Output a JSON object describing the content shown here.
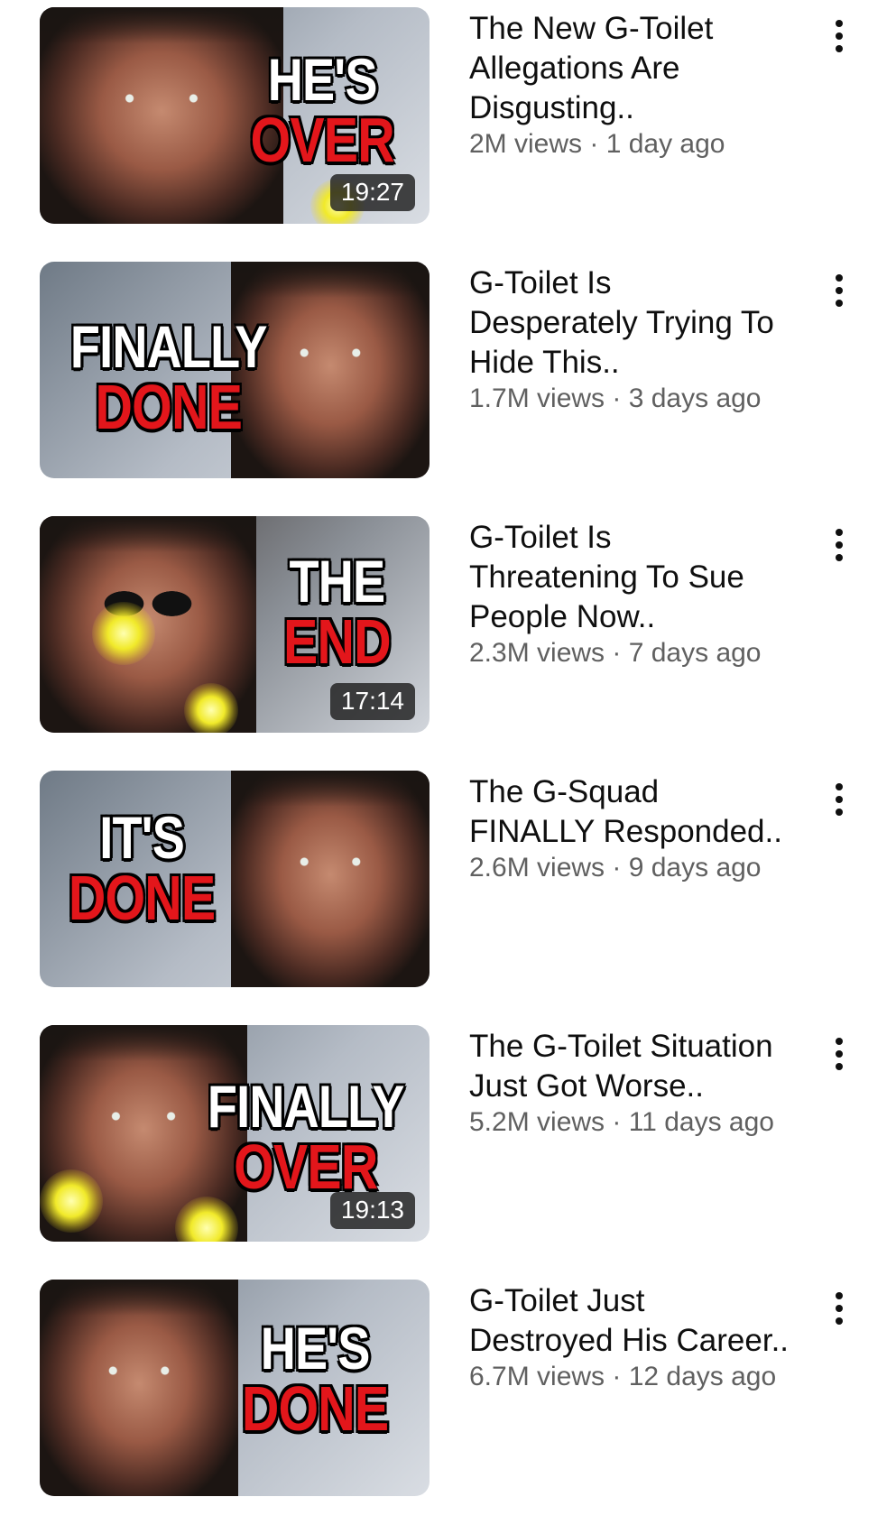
{
  "videos": [
    {
      "thumb_line1": "HE'S",
      "thumb_line2": "OVER",
      "duration": "19:27",
      "title": "The New G-Toilet\nAllegations Are\nDisgusting..",
      "views": "2M views",
      "age": "1 day ago"
    },
    {
      "thumb_line1": "FINALLY",
      "thumb_line2": "DONE",
      "duration": "",
      "title": "G-Toilet  Is\nDesperately Trying To\nHide This..",
      "views": "1.7M views",
      "age": "3 days ago"
    },
    {
      "thumb_line1": "THE",
      "thumb_line2": "END",
      "duration": "17:14",
      "title": "G-Toilet  Is\nThreatening To Sue\nPeople Now..",
      "views": "2.3M views",
      "age": "7 days ago"
    },
    {
      "thumb_line1": "IT'S",
      "thumb_line2": "DONE",
      "duration": "",
      "title": "The  G-Squad\nFINALLY Responded..",
      "views": "2.6M views",
      "age": "9 days ago"
    },
    {
      "thumb_line1": "FINALLY",
      "thumb_line2": "OVER",
      "duration": "19:13",
      "title": "The G-Toilet  Situation\nJust Got Worse..",
      "views": "5.2M views",
      "age": "11 days ago"
    },
    {
      "thumb_line1": "HE'S",
      "thumb_line2": "DONE",
      "duration": "",
      "title": "G-Toilet  Just\nDestroyed His Career..",
      "views": "6.7M views",
      "age": "12 days ago"
    }
  ],
  "separator": " · ",
  "icons": {
    "menu": "more-vert-icon"
  }
}
